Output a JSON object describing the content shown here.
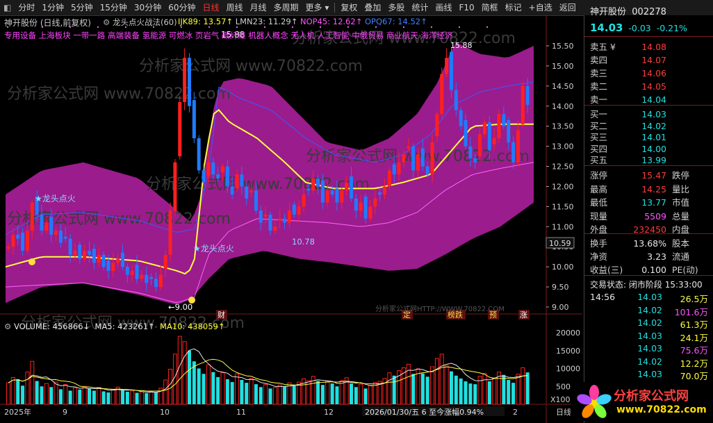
{
  "toolbar": {
    "items": [
      "分时",
      "1分钟",
      "5分钟",
      "15分钟",
      "30分钟",
      "60分钟",
      "日线",
      "周线",
      "月线",
      "多周期",
      "更多 ▾",
      "复权",
      "叠加",
      "多股",
      "统计",
      "画线",
      "F10",
      "简框",
      "标记",
      "+自选",
      "返回"
    ],
    "active": "日线"
  },
  "chart": {
    "stock_title": "神开股份 (日线,前复权)",
    "indicator_name": "龙头点火战法(60)",
    "legend": [
      {
        "label": "IJK89: 13.57↑",
        "color": "#ffff40"
      },
      {
        "label": "LMN23: 11.29↑",
        "color": "#d0d0d0"
      },
      {
        "label": "NOP45: 12.62↑",
        "color": "#ff55ff"
      },
      {
        "label": "OPQ67: 14.52↑",
        "color": "#4080ff"
      }
    ],
    "concepts": "专用设备 上海板块 一带一路 高端装备 氢能源 可燃冰 页岩气 碳纤维 机器人概念 无人机 人工智能 中俄贸易 商业航天 海洋经济",
    "y_ticks": [
      "15.50",
      "15.00",
      "14.50",
      "14.00",
      "13.50",
      "13.00",
      "12.50",
      "12.00",
      "11.50",
      "11.00",
      "10.50",
      "10.00",
      "9.50",
      "9.00"
    ],
    "current_price_tag": "10.59",
    "annotations": {
      "peak1": "15.88",
      "peak2": "15.88",
      "low1": "10.78",
      "low0": "←9.00",
      "signal1": "★龙头点火",
      "signal2": "★龙头点火",
      "cai": "财",
      "ding": "定",
      "bangdie": "榜跌",
      "yu": "预",
      "zhang": "涨"
    },
    "watermark": "分析家公式网HTTP://WWW.70822.COM",
    "bg_watermark": "分析家公式网 www.70822.com"
  },
  "volume": {
    "label": "VOLUME: 456866↓",
    "ma5": "MA5: 423261↑",
    "ma10": "MA10: 438059↑",
    "y_ticks": [
      "20000",
      "15000",
      "10000",
      "5000",
      "X100"
    ]
  },
  "xaxis": {
    "labels": [
      "2025年",
      "9",
      "10",
      "11",
      "12",
      "2026/01/30/五 6 至今涨幅0.94%",
      "2"
    ],
    "right_label": "日线"
  },
  "quote": {
    "name": "神开股份",
    "code": "002278",
    "price": "14.03",
    "change": "-0.03",
    "change_pct": "-0.21%",
    "asks": [
      {
        "label": "卖五 ¥",
        "price": "14.08"
      },
      {
        "label": "卖四",
        "price": "14.07"
      },
      {
        "label": "卖三",
        "price": "14.06"
      },
      {
        "label": "卖二",
        "price": "14.05"
      },
      {
        "label": "卖一",
        "price": "14.04"
      }
    ],
    "bids": [
      {
        "label": "买一",
        "price": "14.03"
      },
      {
        "label": "买二",
        "price": "14.02"
      },
      {
        "label": "买三",
        "price": "14.01"
      },
      {
        "label": "买四",
        "price": "14.00"
      },
      {
        "label": "买五",
        "price": "13.99"
      }
    ],
    "stats": [
      {
        "l1": "涨停",
        "v1": "15.47",
        "c1": "#ff3b3b",
        "l2": "跌停"
      },
      {
        "l1": "最高",
        "v1": "14.25",
        "c1": "#ff3b3b",
        "l2": "量比"
      },
      {
        "l1": "最低",
        "v1": "13.77",
        "c1": "#20e0e0",
        "l2": "市值"
      },
      {
        "l1": "现量",
        "v1": "5509",
        "c1": "#ff55ff",
        "l2": "总量"
      },
      {
        "l1": "外盘",
        "v1": "232450",
        "c1": "#ff3b3b",
        "l2": "内盘"
      }
    ],
    "stats2": [
      {
        "l1": "换手",
        "v1": "13.68%",
        "l2": "股本"
      },
      {
        "l1": "净资",
        "v1": "3.23",
        "l2": "流通"
      },
      {
        "l1": "收益(三)",
        "v1": "0.100",
        "l2": "PE(动)"
      }
    ],
    "trade_status": "交易状态: 闭市阶段",
    "trade_time": "15:33:00",
    "ticks": [
      {
        "time": "14:56",
        "price": "14.03",
        "vol": "26.5万",
        "vcolor": "#ffff40"
      },
      {
        "time": "",
        "price": "14.02",
        "vol": "101.6万",
        "vcolor": "#ff55ff"
      },
      {
        "time": "",
        "price": "14.02",
        "vol": "61.3万",
        "vcolor": "#ffff40"
      },
      {
        "time": "",
        "price": "14.03",
        "vol": "24.1万",
        "vcolor": "#ffff40"
      },
      {
        "time": "",
        "price": "14.03",
        "vol": "75.6万",
        "vcolor": "#ff55ff"
      },
      {
        "time": "",
        "price": "14.02",
        "vol": "12.2万",
        "vcolor": "#ffff40"
      },
      {
        "time": "",
        "price": "14.03",
        "vol": "70.0万",
        "vcolor": "#ffff40"
      }
    ],
    "logo_text": "分析家公式网",
    "logo_url": "www.70822.com"
  },
  "colors": {
    "up": "#ff2020",
    "down": "#1f7bff",
    "band": "#9b1c8c",
    "yellowline": "#ffff40",
    "blueline": "#3a5cff",
    "pinkline": "#ff66ff",
    "cyan": "#20e0e0"
  }
}
